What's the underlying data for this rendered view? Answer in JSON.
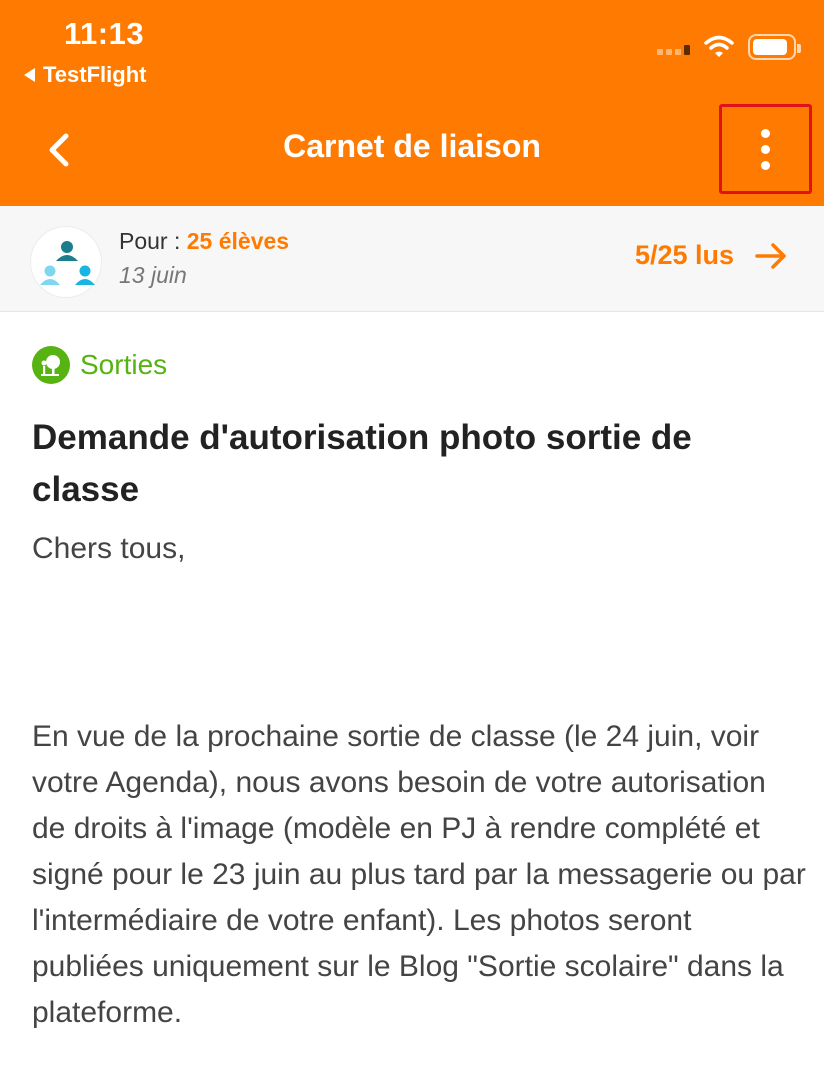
{
  "status_bar": {
    "time": "11:13",
    "back_app": "TestFlight"
  },
  "nav": {
    "title": "Carnet de liaison"
  },
  "recipient": {
    "prefix": "Pour :",
    "count_label": "25 élèves",
    "date": "13 juin",
    "reads": "5/25 lus"
  },
  "message": {
    "category": "Sorties",
    "title": "Demande d'autorisation photo sortie de classe",
    "greeting": "Chers tous,",
    "body": "En vue de la prochaine sortie de classe (le 24 juin, voir votre Agenda), nous avons besoin de votre autorisation de droits à l'image (modèle en PJ à rendre complété et signé pour le 23 juin au plus tard par la messagerie ou par l'intermédiaire de votre enfant). Les photos seront publiées uniquement sur le Blog \"Sortie scolaire\" dans la plateforme."
  },
  "colors": {
    "brand": "#FF7A00",
    "category_green": "#56B312",
    "highlight_border": "#E0121B"
  },
  "icons": [
    "back-icon",
    "more-vertical-icon",
    "arrow-right-icon",
    "group-icon",
    "tree-icon",
    "wifi-icon",
    "battery-icon",
    "signal-icon"
  ]
}
